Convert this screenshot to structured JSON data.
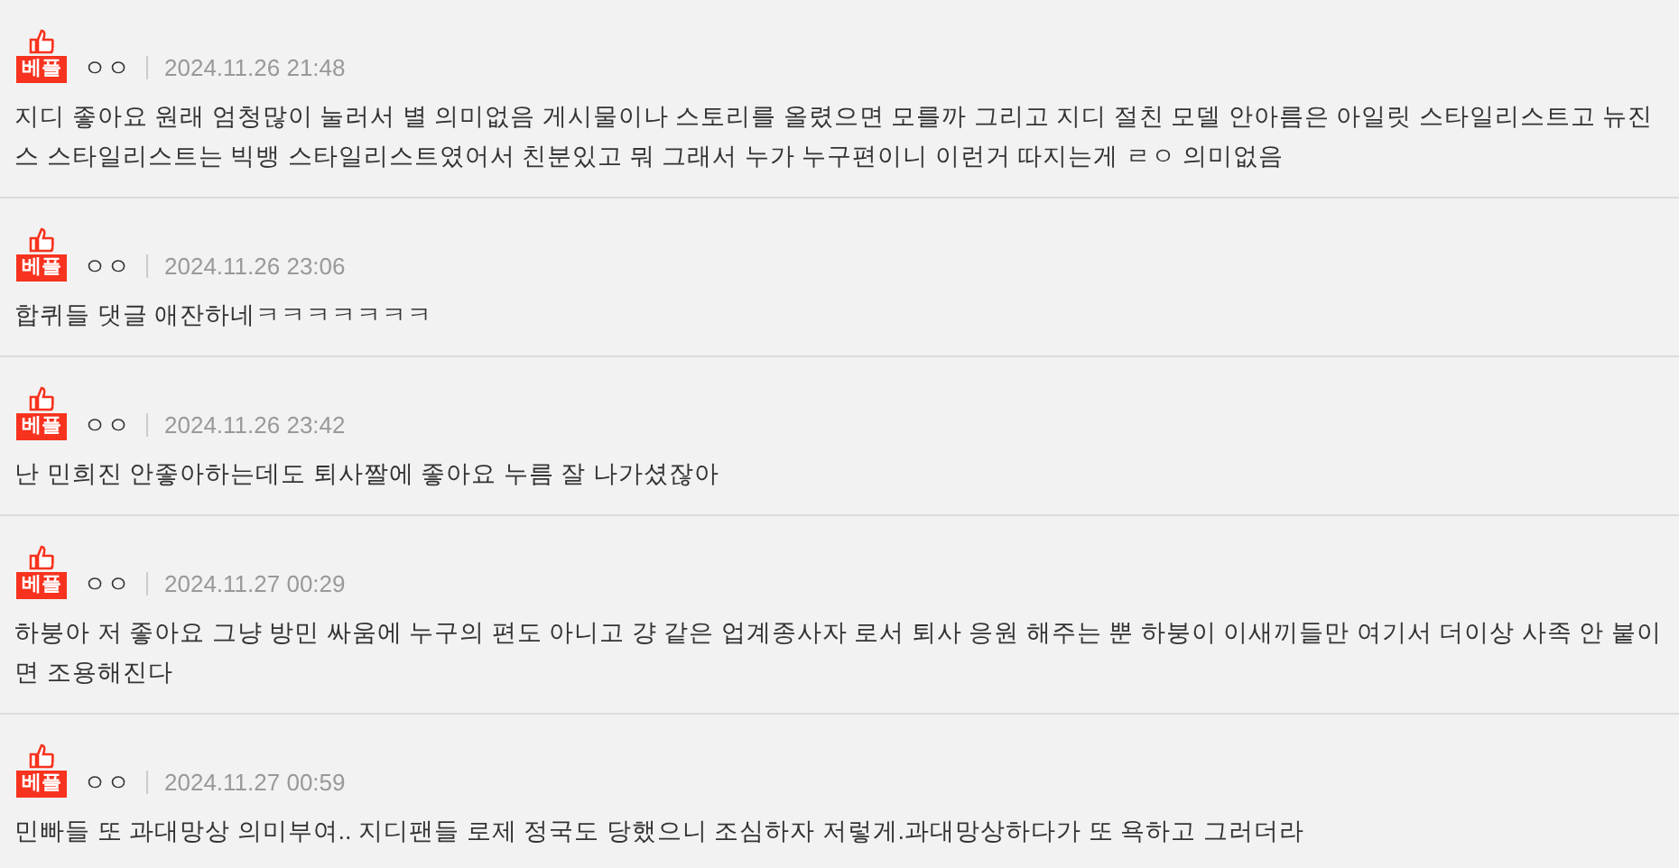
{
  "comments": [
    {
      "badge": "베플",
      "author": "ㅇㅇ",
      "date": "2024.11.26 21:48",
      "text": "지디 좋아요 원래 엄청많이 눌러서 별 의미없음 게시물이나 스토리를 올렸으면 모를까 그리고 지디 절친 모델 안아름은 아일릿 스타일리스트고 뉴진스 스타일리스트는 빅뱅 스타일리스트였어서 친분있고 뭐 그래서 누가 누구편이니 이런거 따지는게 ㄹㅇ 의미없음"
    },
    {
      "badge": "베플",
      "author": "ㅇㅇ",
      "date": "2024.11.26 23:06",
      "text": "합퀴들 댓글 애잔하네ㅋㅋㅋㅋㅋㅋㅋ"
    },
    {
      "badge": "베플",
      "author": "ㅇㅇ",
      "date": "2024.11.26 23:42",
      "text": "난 민희진 안좋아하는데도 퇴사짤에 좋아요 누름 잘 나가셨잖아"
    },
    {
      "badge": "베플",
      "author": "ㅇㅇ",
      "date": "2024.11.27 00:29",
      "text": "하붕아 저 좋아요 그냥 방민 싸움에 누구의 편도 아니고 걍 같은 업계종사자 로서 퇴사 응원 해주는 뿐 하붕이 이새끼들만 여기서 더이상 사족 안 붙이면 조용해진다"
    },
    {
      "badge": "베플",
      "author": "ㅇㅇ",
      "date": "2024.11.27 00:59",
      "text": "민빠들 또 과대망상 의미부여.. 지디팬들 로제 정국도 당했으니 조심하자 저렇게.과대망상하다가 또 욕하고 그러더라"
    }
  ]
}
